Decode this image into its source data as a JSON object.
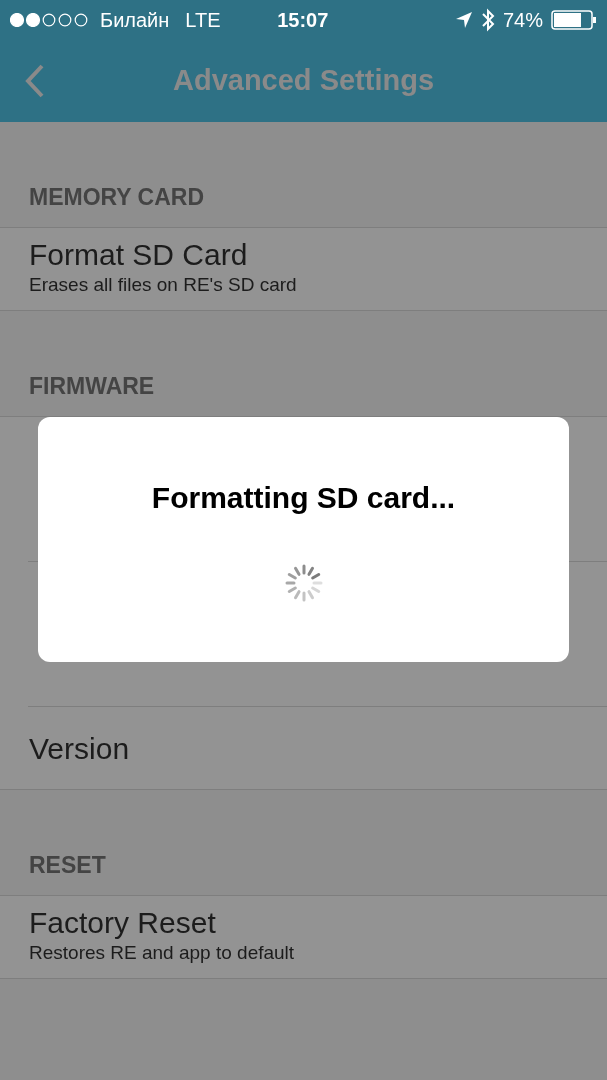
{
  "status_bar": {
    "carrier": "Билайн",
    "network": "LTE",
    "time": "15:07",
    "battery_text": "74%"
  },
  "nav": {
    "title": "Advanced Settings"
  },
  "sections": [
    {
      "header": "MEMORY CARD",
      "rows": [
        {
          "kind": "detail",
          "title": "Format SD Card",
          "subtitle": "Erases all files on RE's SD card"
        }
      ]
    },
    {
      "header": "FIRMWARE",
      "rows": [
        {
          "kind": "covered"
        },
        {
          "kind": "covered"
        },
        {
          "kind": "plain",
          "title": "Version"
        }
      ]
    },
    {
      "header": "RESET",
      "rows": [
        {
          "kind": "detail",
          "title": "Factory Reset",
          "subtitle": "Restores RE and app to default"
        }
      ]
    }
  ],
  "dialog": {
    "title": "Formatting SD card..."
  }
}
